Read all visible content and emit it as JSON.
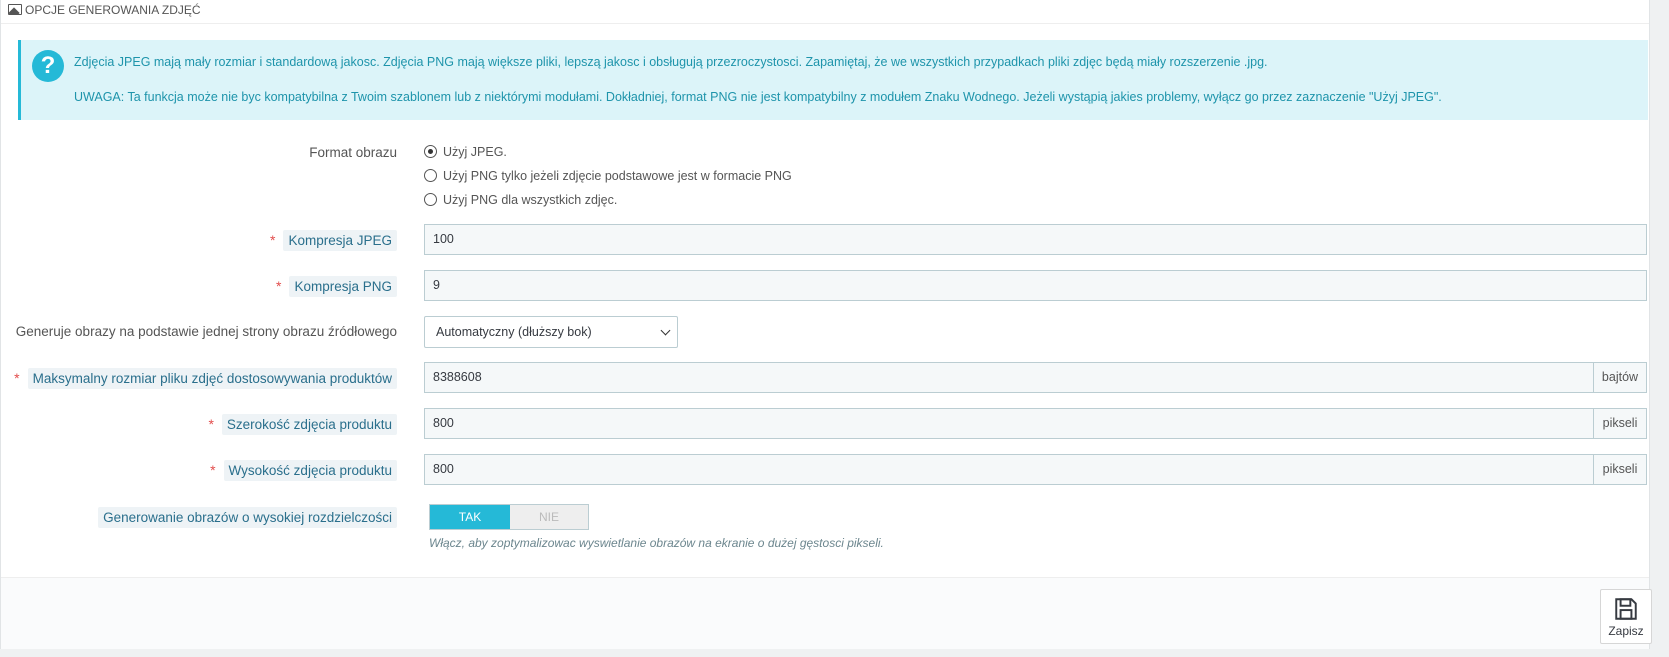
{
  "panel": {
    "title": "OPCJE GENEROWANIA ZDJĘĆ"
  },
  "alert": {
    "line1": "Zdjęcia JPEG mają mały rozmiar i standardową jakosc. Zdjęcia PNG mają większe pliki, lepszą jakosc i obsługują przezroczystosci. Zapamiętaj, że we wszystkich przypadkach pliki zdjęc będą miały rozszerzenie .jpg.",
    "line2": "UWAGA: Ta funkcja może nie byc kompatybilna z Twoim szablonem lub z niektórymi modułami. Dokładniej, format PNG nie jest kompatybilny z modułem Znaku Wodnego. Jeżeli wystąpią jakies problemy, wyłącz go przez zaznaczenie \"Użyj JPEG\"."
  },
  "format": {
    "label": "Format obrazu",
    "options": [
      {
        "label": "Użyj JPEG.",
        "checked": true
      },
      {
        "label": "Użyj PNG tylko jeżeli zdjęcie podstawowe jest w formacie PNG",
        "checked": false
      },
      {
        "label": "Użyj PNG dla wszystkich zdjęc.",
        "checked": false
      }
    ]
  },
  "jpeg_compression": {
    "label": "Kompresja JPEG",
    "value": "100"
  },
  "png_compression": {
    "label": "Kompresja PNG",
    "value": "9"
  },
  "source_side": {
    "label": "Generuje obrazy na podstawie jednej strony obrazu źródłowego",
    "selected": "Automatyczny (dłuższy bok)"
  },
  "max_file_size": {
    "label": "Maksymalny rozmiar pliku zdjęć dostosowywania produktów",
    "value": "8388608",
    "unit": "bajtów"
  },
  "product_width": {
    "label": "Szerokość zdjęcia produktu",
    "value": "800",
    "unit": "pikseli"
  },
  "product_height": {
    "label": "Wysokość zdjęcia produktu",
    "value": "800",
    "unit": "pikseli"
  },
  "high_dpi": {
    "label": "Generowanie obrazów o wysokiej rozdzielczości",
    "yes": "TAK",
    "no": "NIE",
    "enabled": true,
    "help": "Włącz, aby zoptymalizowac wyswietlanie obrazów na ekranie o dużej gęstosci pikseli."
  },
  "footer": {
    "save_label": "Zapisz"
  },
  "colors": {
    "accent": "#25b9d7",
    "required": "#e24c4b",
    "alert_bg": "#dcf4f9"
  },
  "icons": {
    "header": "image-icon",
    "alert": "question-circle-icon",
    "save": "floppy-disk-icon"
  }
}
